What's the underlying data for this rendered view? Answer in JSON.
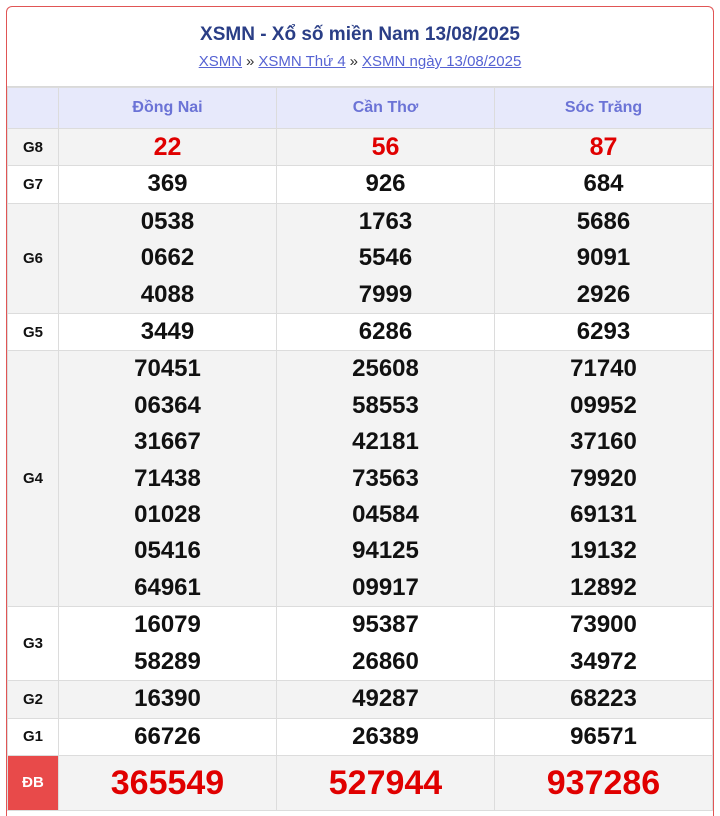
{
  "header": {
    "title": "XSMN - Xổ số miền Nam 13/08/2025",
    "breadcrumbs": [
      "XSMN",
      "XSMN Thứ 4",
      "XSMN ngày 13/08/2025"
    ],
    "separator": "»"
  },
  "provinces": [
    "Đồng Nai",
    "Cần Thơ",
    "Sóc Trăng"
  ],
  "prizes": [
    {
      "label": "G8",
      "results": [
        [
          "22"
        ],
        [
          "56"
        ],
        [
          "87"
        ]
      ]
    },
    {
      "label": "G7",
      "results": [
        [
          "369"
        ],
        [
          "926"
        ],
        [
          "684"
        ]
      ]
    },
    {
      "label": "G6",
      "results": [
        [
          "0538",
          "0662",
          "4088"
        ],
        [
          "1763",
          "5546",
          "7999"
        ],
        [
          "5686",
          "9091",
          "2926"
        ]
      ]
    },
    {
      "label": "G5",
      "results": [
        [
          "3449"
        ],
        [
          "6286"
        ],
        [
          "6293"
        ]
      ]
    },
    {
      "label": "G4",
      "results": [
        [
          "70451",
          "06364",
          "31667",
          "71438",
          "01028",
          "05416",
          "64961"
        ],
        [
          "25608",
          "58553",
          "42181",
          "73563",
          "04584",
          "94125",
          "09917"
        ],
        [
          "71740",
          "09952",
          "37160",
          "79920",
          "69131",
          "19132",
          "12892"
        ]
      ]
    },
    {
      "label": "G3",
      "results": [
        [
          "16079",
          "58289"
        ],
        [
          "95387",
          "26860"
        ],
        [
          "73900",
          "34972"
        ]
      ]
    },
    {
      "label": "G2",
      "results": [
        [
          "16390"
        ],
        [
          "49287"
        ],
        [
          "68223"
        ]
      ]
    },
    {
      "label": "G1",
      "results": [
        [
          "66726"
        ],
        [
          "26389"
        ],
        [
          "96571"
        ]
      ]
    },
    {
      "label": "ĐB",
      "results": [
        [
          "365549"
        ],
        [
          "527944"
        ],
        [
          "937286"
        ]
      ]
    }
  ],
  "colors": {
    "accent": "#2a3e86",
    "header_bg": "#e7e9fb",
    "prize_red": "#e00000",
    "special_bg": "#e84a4a"
  }
}
